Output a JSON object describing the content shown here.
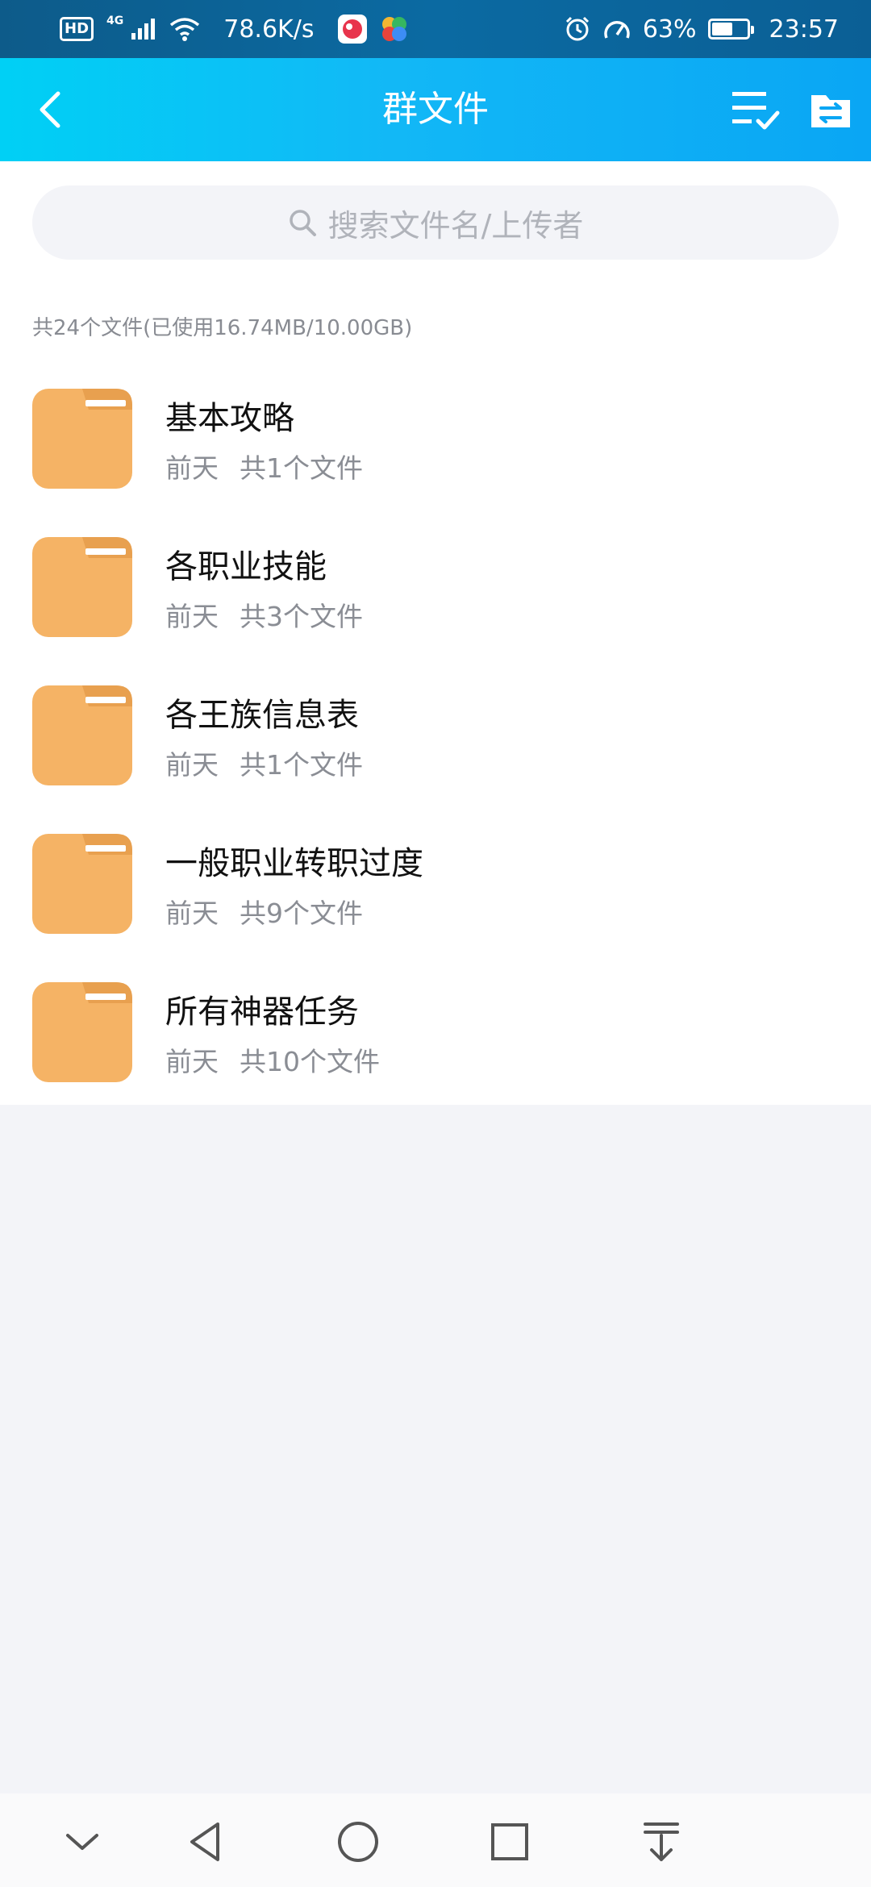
{
  "status_bar": {
    "hd": "HD",
    "network": "4G",
    "speed": "78.6K/s",
    "battery_percent": "63%",
    "battery_level": 0.63,
    "time": "23:57"
  },
  "header": {
    "title": "群文件",
    "icons": [
      "back-icon",
      "multi-select-icon",
      "file-transfer-icon"
    ]
  },
  "search": {
    "placeholder": "搜索文件名/上传者"
  },
  "summary": "共24个文件(已使用16.74MB/10.00GB)",
  "folders": [
    {
      "name": "基本攻略",
      "date": "前天",
      "count": "共1个文件"
    },
    {
      "name": "各职业技能",
      "date": "前天",
      "count": "共3个文件"
    },
    {
      "name": "各王族信息表",
      "date": "前天",
      "count": "共1个文件"
    },
    {
      "name": "一般职业转职过度",
      "date": "前天",
      "count": "共9个文件"
    },
    {
      "name": "所有神器任务",
      "date": "前天",
      "count": "共10个文件"
    }
  ],
  "colors": {
    "folder": "#f5b365",
    "header_start": "#00d0f5",
    "header_end": "#0aa6f4",
    "background": "#f3f4f8"
  }
}
